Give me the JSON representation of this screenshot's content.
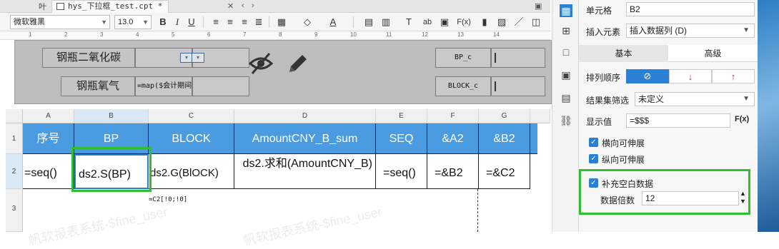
{
  "tabbar": {
    "left_glyph": "叶",
    "file_tab": "hys_下拉框_test.cpt *",
    "mini_icons": [
      "✕",
      "‹",
      "›",
      "▣"
    ]
  },
  "format_toolbar": {
    "font_family": "微软雅黑",
    "font_size": "13.0",
    "bold": "B",
    "italic": "I",
    "underline": "U",
    "font_color": "A",
    "fx": "F(x)",
    "ab": "ab"
  },
  "ruler": {
    "labels": [
      "1",
      "2",
      "3",
      "4",
      "5",
      "6",
      "7",
      "8",
      "9",
      "10",
      "11",
      "12",
      "13",
      "14"
    ]
  },
  "params": {
    "label1": "钢瓶二氧化碳",
    "label2": "钢瓶氧气",
    "formula": "=map($会计期间",
    "field1": "BP_c",
    "field2": "BLOCK_c"
  },
  "grid": {
    "columns": [
      "A",
      "B",
      "C",
      "D",
      "E",
      "F",
      "G"
    ],
    "selected_column": "B",
    "rows": [
      "1",
      "2",
      "3"
    ],
    "header_row": [
      "序号",
      "BP",
      "BLOCK",
      "AmountCNY_B_sum",
      "SEQ",
      "&A2",
      "&B2"
    ],
    "data_row": [
      "=seq()",
      "ds2.S(BP)",
      "ds2.G(BlOCK)",
      "ds2.求和(AmountCNY_B)",
      "=seq()",
      "=&B2",
      "=&C2"
    ],
    "row3_note": "=C2[!0;!0]",
    "watermark": "帆软报表系统-$fine_user"
  },
  "side_icons": [
    "cell-attr",
    "widget",
    "border",
    "dropdown",
    "hyperlink",
    "link"
  ],
  "panel": {
    "cell_label": "单元格",
    "cell_value": "B2",
    "insert_label": "插入元素",
    "insert_value": "插入数据列 (D)",
    "tab_basic": "基本",
    "tab_advanced": "高级",
    "sort_label": "排列顺序",
    "sort_options": [
      "⊘",
      "↓",
      "↑"
    ],
    "filter_label": "结果集筛选",
    "filter_value": "未定义",
    "display_label": "显示值",
    "display_value": "=$$$",
    "fx_label": "F(x)",
    "chk_horizontal": "横向可伸展",
    "chk_vertical": "纵向可伸展",
    "chk_fill_blank": "补充空白数据",
    "multiple_label": "数据倍数",
    "multiple_value": "12"
  }
}
